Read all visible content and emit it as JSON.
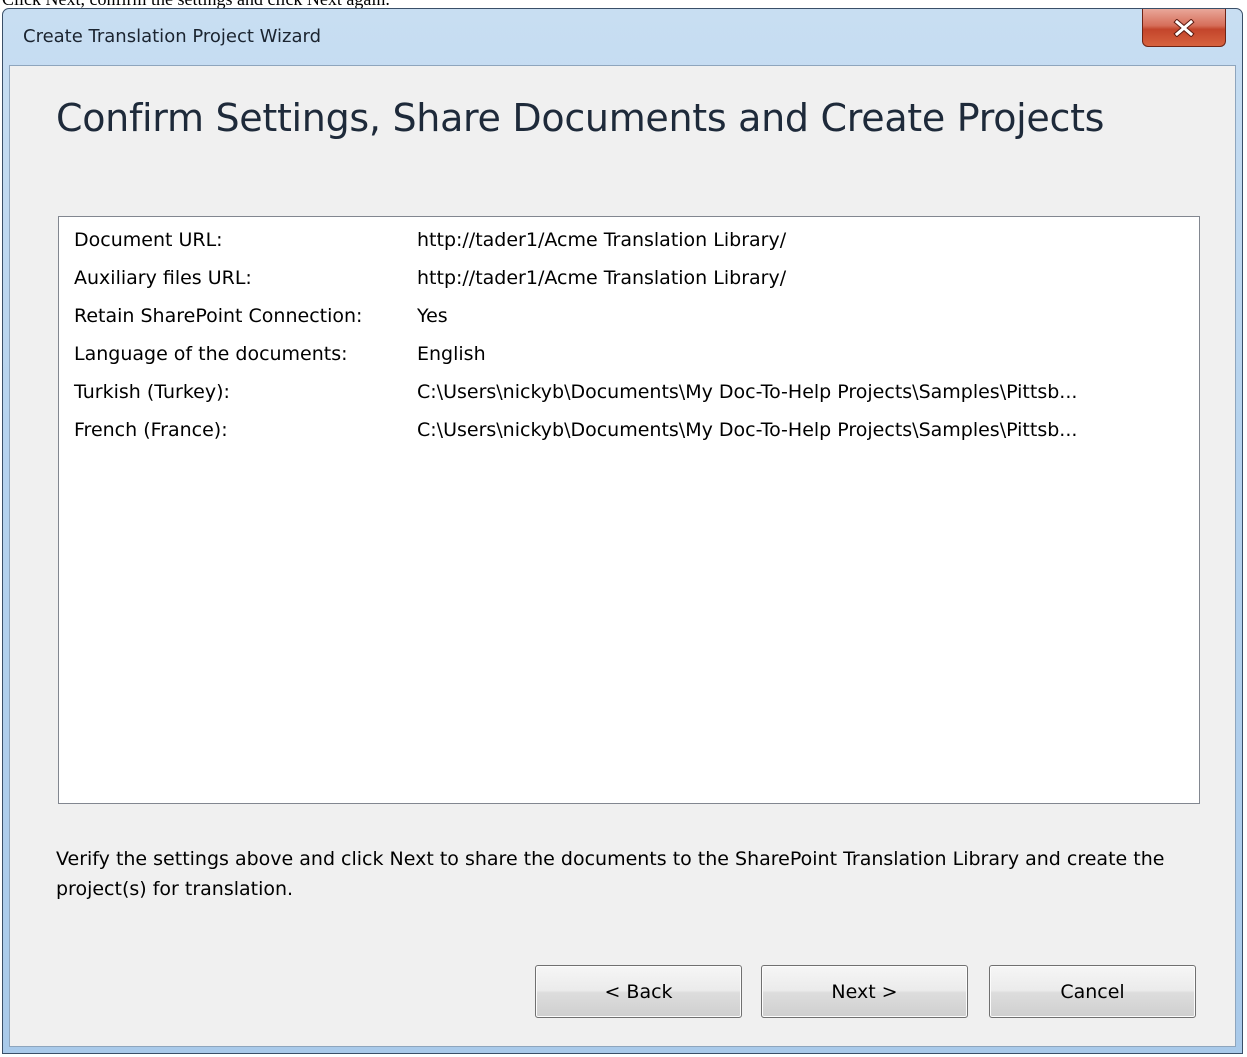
{
  "caption": "Click Next, confirm the settings and click Next again.",
  "window": {
    "title": "Create Translation Project Wizard",
    "close_icon": "close-x-icon"
  },
  "page": {
    "heading": "Confirm Settings, Share Documents and Create Projects",
    "settings": [
      {
        "label": "Document URL:",
        "value": "http://tader1/Acme Translation Library/"
      },
      {
        "label": "Auxiliary files URL:",
        "value": "http://tader1/Acme Translation Library/"
      },
      {
        "label": "Retain SharePoint Connection:",
        "value": "Yes"
      },
      {
        "label": "Language of the documents:",
        "value": "English"
      },
      {
        "label": "Turkish (Turkey):",
        "value": "C:\\Users\\nickyb\\Documents\\My Doc-To-Help Projects\\Samples\\Pittsb..."
      },
      {
        "label": "French (France):",
        "value": "C:\\Users\\nickyb\\Documents\\My Doc-To-Help Projects\\Samples\\Pittsb..."
      }
    ],
    "instructions": "Verify the settings above and click Next to share the documents to the SharePoint Translation Library and create the project(s) for translation."
  },
  "buttons": {
    "back": "< Back",
    "next": "Next >",
    "cancel": "Cancel"
  }
}
